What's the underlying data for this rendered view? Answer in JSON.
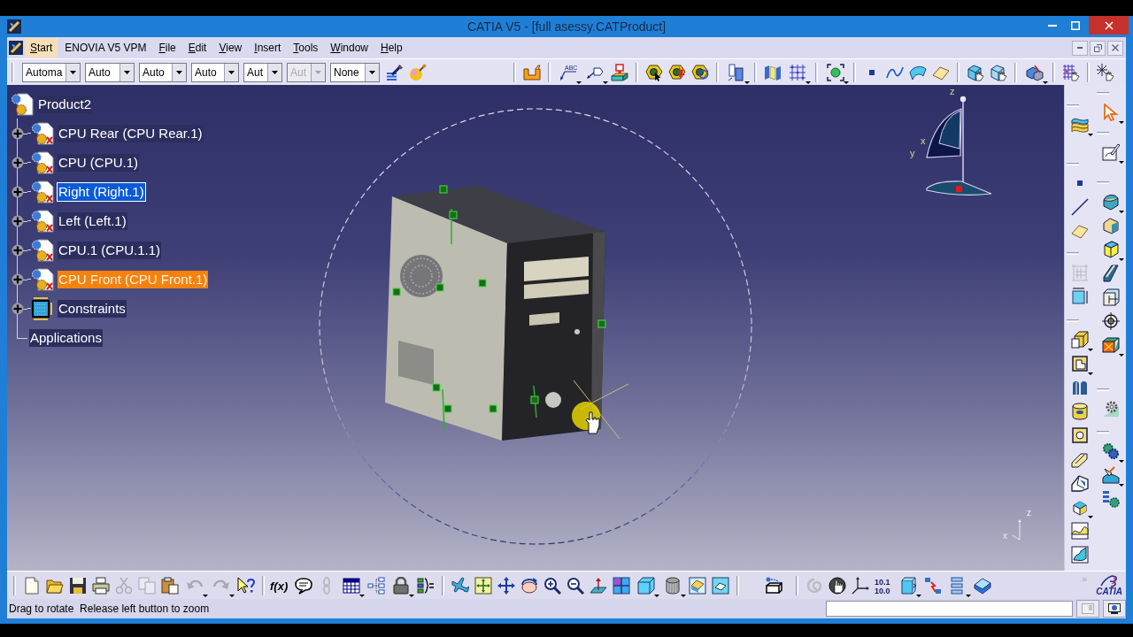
{
  "window": {
    "title": "CATIA V5 - [full asessy.CATProduct]"
  },
  "menu_bar": {
    "items": [
      {
        "label": "Start",
        "selected": true,
        "underline_first": true
      },
      {
        "label": "ENOVIA V5 VPM",
        "selected": false,
        "underline_first": false
      },
      {
        "label": "File",
        "selected": false,
        "underline_first": true
      },
      {
        "label": "Edit",
        "selected": false,
        "underline_first": true
      },
      {
        "label": "View",
        "selected": false,
        "underline_first": true
      },
      {
        "label": "Insert",
        "selected": false,
        "underline_first": true
      },
      {
        "label": "Tools",
        "selected": false,
        "underline_first": true
      },
      {
        "label": "Window",
        "selected": false,
        "underline_first": true
      },
      {
        "label": "Help",
        "selected": false,
        "underline_first": true
      }
    ]
  },
  "toolbar_top": {
    "combos": [
      {
        "value": "Automa",
        "disabled": false
      },
      {
        "value": "Auto",
        "disabled": false
      },
      {
        "value": "Auto",
        "disabled": false
      },
      {
        "value": "Auto",
        "disabled": false
      },
      {
        "value": "Aut",
        "disabled": false
      },
      {
        "value": "Aut",
        "disabled": true
      },
      {
        "value": "None",
        "disabled": false
      }
    ],
    "tools": [
      {
        "kind": "painter"
      },
      {
        "kind": "sphere-wand"
      }
    ],
    "groups": [
      [
        {
          "kind": "bracket"
        }
      ],
      [
        {
          "kind": "text-leader",
          "label": "ABC",
          "dropdown": true
        },
        {
          "kind": "flag-note",
          "dropdown": true
        },
        {
          "kind": "stamp"
        }
      ],
      [
        {
          "kind": "hex-arrow"
        },
        {
          "kind": "hex-star"
        },
        {
          "kind": "hex-ring"
        }
      ],
      [
        {
          "kind": "blocks",
          "dropdown": true
        }
      ],
      [
        {
          "kind": "planes"
        },
        {
          "kind": "dot-grid",
          "dropdown": true
        }
      ],
      [
        {
          "kind": "fit-target",
          "dropdown": true
        }
      ],
      [
        {
          "kind": "point"
        },
        {
          "kind": "curve"
        },
        {
          "kind": "surface"
        },
        {
          "kind": "plane"
        }
      ],
      [
        {
          "kind": "cube-hand"
        },
        {
          "kind": "cube-hand-2"
        }
      ],
      [
        {
          "kind": "assembly",
          "dropdown": true
        }
      ],
      [
        {
          "kind": "grid-hand"
        }
      ],
      [
        {
          "kind": "sparkle-hand"
        }
      ]
    ]
  },
  "tree": {
    "label": "Product2",
    "kind": "product",
    "selected": false,
    "highlighted": false,
    "children": [
      {
        "label": "CPU Rear (CPU Rear.1)",
        "kind": "component",
        "expanded": false,
        "selected": false,
        "highlighted": false
      },
      {
        "label": "CPU (CPU.1)",
        "kind": "component",
        "expanded": false,
        "selected": false,
        "highlighted": false
      },
      {
        "label": "Right (Right.1)",
        "kind": "component",
        "expanded": false,
        "selected": true,
        "highlighted": false
      },
      {
        "label": "Left (Left.1)",
        "kind": "component",
        "expanded": false,
        "selected": false,
        "highlighted": false
      },
      {
        "label": "CPU.1 (CPU.1.1)",
        "kind": "component",
        "expanded": false,
        "selected": false,
        "highlighted": false
      },
      {
        "label": "CPU Front (CPU Front.1)",
        "kind": "component",
        "expanded": false,
        "selected": false,
        "highlighted": true
      },
      {
        "label": "Constraints",
        "kind": "constraints",
        "expanded": false,
        "selected": false,
        "highlighted": false
      },
      {
        "label": "Applications",
        "kind": "applications",
        "selected": false,
        "highlighted": false
      }
    ]
  },
  "compass": {
    "z": "z",
    "x": "x",
    "y": "y"
  },
  "triad": {
    "z": "z",
    "x": "x"
  },
  "right_toolbar": {
    "columns": [
      [
        [
          {
            "kind": "surfaces",
            "dropdown": true,
            "disabled": false
          }
        ],
        [
          {
            "kind": "point",
            "disabled": false
          },
          {
            "kind": "line",
            "disabled": false
          },
          {
            "kind": "plane",
            "disabled": false
          }
        ],
        [
          {
            "kind": "dim-grid",
            "disabled": true
          },
          {
            "kind": "cube-dims",
            "disabled": false
          }
        ],
        [
          {
            "kind": "pad",
            "dropdown": true,
            "disabled": false
          },
          {
            "kind": "pocket",
            "dropdown": true,
            "disabled": false
          },
          {
            "kind": "split",
            "disabled": false
          },
          {
            "kind": "shaft",
            "disabled": false
          },
          {
            "kind": "hole",
            "disabled": false
          },
          {
            "kind": "rib",
            "disabled": false
          },
          {
            "kind": "slot",
            "disabled": false
          },
          {
            "kind": "small-cube",
            "dropdown": true,
            "disabled": false
          },
          {
            "kind": "surf-wave",
            "disabled": false
          },
          {
            "kind": "surf-wave-2",
            "disabled": false
          }
        ]
      ],
      [
        [
          {
            "kind": "cursor",
            "dropdown": true,
            "disabled": false
          }
        ],
        [
          {
            "kind": "sketch",
            "dropdown": true,
            "disabled": false
          }
        ],
        [
          {
            "kind": "fillet",
            "dropdown": true,
            "disabled": false
          },
          {
            "kind": "chamfer",
            "disabled": false
          },
          {
            "kind": "block",
            "dropdown": true,
            "disabled": false
          },
          {
            "kind": "draft",
            "disabled": false
          },
          {
            "kind": "cube-cut",
            "disabled": false
          },
          {
            "kind": "target",
            "disabled": false
          },
          {
            "kind": "box-x",
            "dropdown": true,
            "disabled": false
          }
        ],
        [
          {
            "kind": "gear",
            "disabled": false
          }
        ],
        [
          {
            "kind": "gears",
            "dropdown": true,
            "disabled": false
          },
          {
            "kind": "surf-hand",
            "dropdown": true,
            "disabled": false
          },
          {
            "kind": "gear-tree",
            "disabled": false
          }
        ]
      ]
    ]
  },
  "bottom_toolbar": {
    "groups": [
      [
        {
          "kind": "new",
          "disabled": false
        },
        {
          "kind": "open",
          "disabled": false
        },
        {
          "kind": "save",
          "disabled": false
        },
        {
          "kind": "print",
          "disabled": false
        },
        {
          "kind": "cut",
          "disabled": true
        },
        {
          "kind": "copy",
          "disabled": true
        },
        {
          "kind": "paste",
          "disabled": false
        },
        {
          "kind": "undo",
          "dropdown": true,
          "disabled": true
        },
        {
          "kind": "redo",
          "dropdown": true,
          "disabled": true
        },
        {
          "kind": "help",
          "disabled": false
        }
      ],
      [
        {
          "kind": "formula",
          "label": "f(x)",
          "disabled": false
        },
        {
          "kind": "comment",
          "disabled": false
        },
        {
          "kind": "link",
          "disabled": true
        },
        {
          "kind": "table",
          "dropdown": true,
          "disabled": false
        },
        {
          "kind": "tree",
          "disabled": false
        },
        {
          "kind": "lock",
          "dropdown": true,
          "disabled": false
        },
        {
          "kind": "equation",
          "disabled": false
        }
      ],
      [
        {
          "kind": "fly",
          "disabled": false
        },
        {
          "kind": "fit",
          "disabled": false
        },
        {
          "kind": "pan",
          "disabled": false
        },
        {
          "kind": "rotate",
          "disabled": false
        },
        {
          "kind": "zoom-in",
          "disabled": false
        },
        {
          "kind": "zoom-out",
          "disabled": false
        },
        {
          "kind": "normal",
          "disabled": false
        },
        {
          "kind": "quad",
          "disabled": false
        },
        {
          "kind": "cube",
          "dropdown": true,
          "disabled": false
        },
        {
          "kind": "cylinder",
          "dropdown": true,
          "disabled": false
        },
        {
          "kind": "shading",
          "disabled": false
        },
        {
          "kind": "hide",
          "disabled": false
        }
      ],
      [
        {
          "kind": "box-arrow",
          "disabled": false
        }
      ],
      [
        {
          "kind": "swirl",
          "disabled": true
        },
        {
          "kind": "hand",
          "disabled": false
        },
        {
          "kind": "axes",
          "disabled": false
        },
        {
          "kind": "units",
          "lines": [
            "10.1",
            "10.0"
          ],
          "disabled": false
        },
        {
          "kind": "cube-arrows",
          "dropdown": true,
          "disabled": false
        },
        {
          "kind": "lightning",
          "disabled": false
        },
        {
          "kind": "list",
          "dropdown": true,
          "disabled": false
        },
        {
          "kind": "book",
          "disabled": false
        }
      ]
    ],
    "overflow": "»",
    "logo": "CATIA"
  },
  "status_bar": {
    "message": "Drag to rotate  Release left button to zoom",
    "buttons": [
      {
        "kind": "window",
        "disabled": true
      },
      {
        "kind": "info",
        "disabled": false
      }
    ]
  }
}
